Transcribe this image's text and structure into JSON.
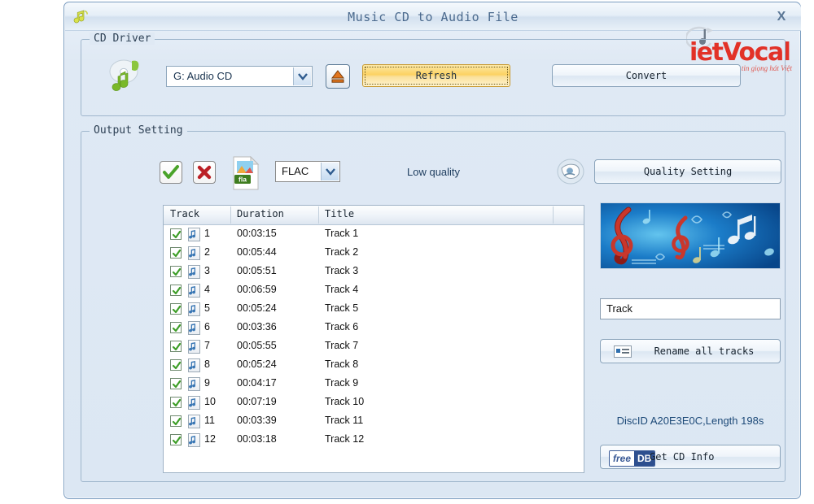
{
  "window": {
    "title": "Music CD to Audio File",
    "app_icon": "music-note-icon",
    "close_label": "X"
  },
  "brand": {
    "wordmark_prefix": "iet",
    "wordmark_suffix": "Vocal",
    "wordmark": "ietVocal",
    "tagline": "Tự tin giọng hát Việt",
    "color": "#e23127"
  },
  "cd_driver": {
    "group_title": "CD Driver",
    "drive_value": "G: Audio CD",
    "eject_label": "",
    "refresh_label": "Refresh",
    "convert_label": "Convert"
  },
  "output_setting": {
    "group_title": "Output Setting",
    "select_all_label": "",
    "deselect_all_label": "",
    "format_value": "FLAC",
    "format_icon_label": "fla",
    "quality_text": "Low quality",
    "quality_setting_label": "Quality Setting"
  },
  "track_table": {
    "columns": [
      "Track",
      "Duration",
      "Title"
    ],
    "rows": [
      {
        "checked": true,
        "num": "1",
        "duration": "00:03:15",
        "title": "Track 1"
      },
      {
        "checked": true,
        "num": "2",
        "duration": "00:05:44",
        "title": "Track 2"
      },
      {
        "checked": true,
        "num": "3",
        "duration": "00:05:51",
        "title": "Track 3"
      },
      {
        "checked": true,
        "num": "4",
        "duration": "00:06:59",
        "title": "Track 4"
      },
      {
        "checked": true,
        "num": "5",
        "duration": "00:05:24",
        "title": "Track 5"
      },
      {
        "checked": true,
        "num": "6",
        "duration": "00:03:36",
        "title": "Track 6"
      },
      {
        "checked": true,
        "num": "7",
        "duration": "00:05:55",
        "title": "Track 7"
      },
      {
        "checked": true,
        "num": "8",
        "duration": "00:05:24",
        "title": "Track 8"
      },
      {
        "checked": true,
        "num": "9",
        "duration": "00:04:17",
        "title": "Track 9"
      },
      {
        "checked": true,
        "num": "10",
        "duration": "00:07:19",
        "title": "Track 10"
      },
      {
        "checked": true,
        "num": "11",
        "duration": "00:03:39",
        "title": "Track 11"
      },
      {
        "checked": true,
        "num": "12",
        "duration": "00:03:18",
        "title": "Track 12"
      }
    ]
  },
  "right_panel": {
    "banner_alt": "music-notes-banner",
    "name_value": "Track",
    "rename_label": "Rename all tracks",
    "discid_text": "DiscID A20E3E0C,Length 198s",
    "freedb_free": "free",
    "freedb_db": "DB",
    "get_cd_info_label": "Get CD Info"
  }
}
